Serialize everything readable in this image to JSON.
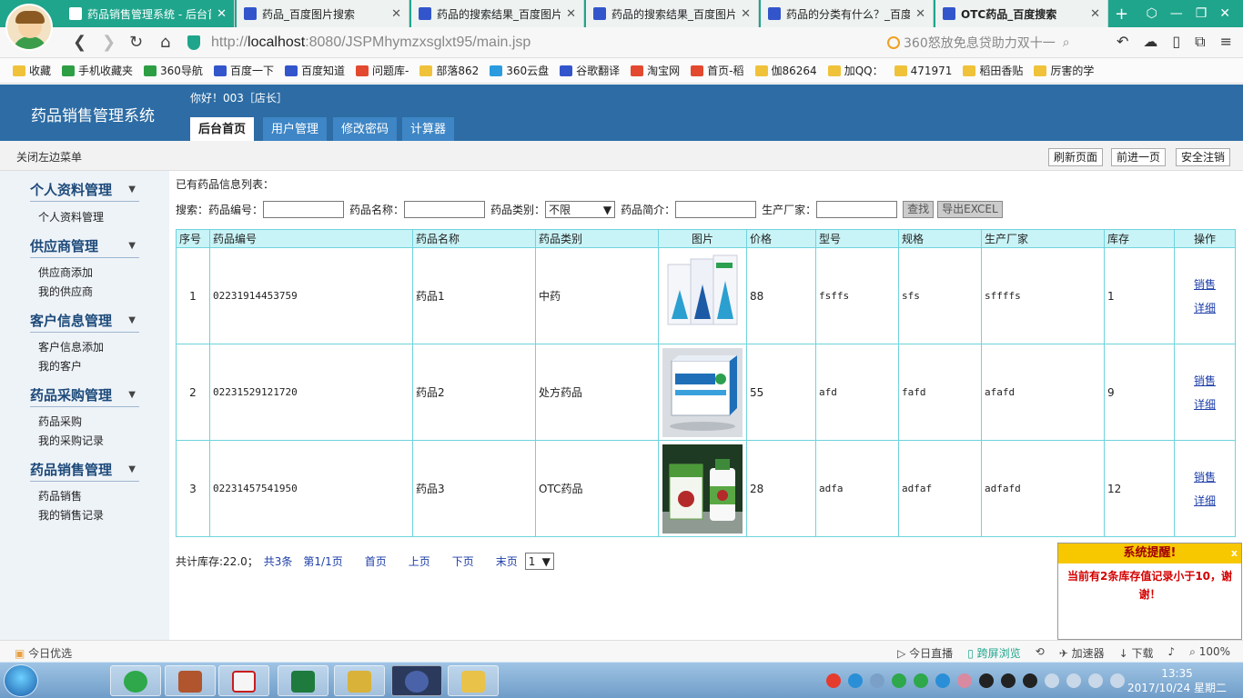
{
  "browser": {
    "tabs": [
      {
        "label": "药品销售管理系统 - 后台首页",
        "active": true
      },
      {
        "label": "药品_百度图片搜索"
      },
      {
        "label": "药品的搜索结果_百度图片"
      },
      {
        "label": "药品的搜索结果_百度图片"
      },
      {
        "label": "药品的分类有什么？_百度"
      },
      {
        "label": "OTC药品_百度搜索"
      }
    ],
    "url_prefix": "http://",
    "url_host": "localhost",
    "url_path": ":8080/JSPMhymzxsglxt95/main.jsp",
    "search_text": "360怒放免息贷助力双十一",
    "bookmarks": [
      "收藏",
      "手机收藏夹",
      "360导航",
      "百度一下",
      "百度知道",
      "问题库-",
      "部落862",
      "360云盘",
      "谷歌翻译",
      "淘宝网",
      "首页-稻",
      "伽86264",
      "加QQ：",
      "471971",
      "稻田香贴",
      "厉害的学"
    ]
  },
  "app": {
    "title": "药品销售管理系统",
    "greeting": "你好！003［店长］",
    "nav_tabs": [
      "后台首页",
      "用户管理",
      "修改密码",
      "计算器"
    ],
    "close_menu": "关闭左边菜单",
    "top_buttons": [
      "刷新页面",
      "前进一页",
      "安全注销"
    ]
  },
  "sidebar": {
    "groups": [
      {
        "title": "个人资料管理",
        "items": [
          "个人资料管理"
        ]
      },
      {
        "title": "供应商管理",
        "items": [
          "供应商添加",
          "我的供应商"
        ]
      },
      {
        "title": "客户信息管理",
        "items": [
          "客户信息添加",
          "我的客户"
        ]
      },
      {
        "title": "药品采购管理",
        "items": [
          "药品采购",
          "我的采购记录"
        ]
      },
      {
        "title": "药品销售管理",
        "items": [
          "药品销售",
          "我的销售记录"
        ]
      }
    ]
  },
  "main": {
    "list_title": "已有药品信息列表：",
    "search": {
      "label": "搜索：",
      "code_label": "药品编号：",
      "name_label": "药品名称：",
      "category_label": "药品类别：",
      "category_value": "不限",
      "intro_label": "药品简介：",
      "maker_label": "生产厂家：",
      "search_button": "查找",
      "export_button": "导出EXCEL"
    },
    "table": {
      "headers": [
        "序号",
        "药品编号",
        "药品名称",
        "药品类别",
        "图片",
        "价格",
        "型号",
        "规格",
        "生产厂家",
        "库存",
        "操作"
      ],
      "rows": [
        {
          "no": "1",
          "code": "02231914453759",
          "name": "药品1",
          "category": "中药",
          "price": "88",
          "model": "fsffs",
          "spec": "sfs",
          "maker": "sffffs",
          "stock": "1",
          "image": "white medicine boxes"
        },
        {
          "no": "2",
          "code": "02231529121720",
          "name": "药品2",
          "category": "处方药品",
          "price": "55",
          "model": "afd",
          "spec": "fafd",
          "maker": "afafd",
          "stock": "9",
          "image": "blue medicine box"
        },
        {
          "no": "3",
          "code": "02231457541950",
          "name": "药品3",
          "category": "OTC药品",
          "price": "28",
          "model": "adfa",
          "spec": "adfaf",
          "maker": "adfafd",
          "stock": "12",
          "image": "green bottle and box"
        }
      ],
      "ops": [
        "销售",
        "详细"
      ]
    },
    "pager": {
      "stock_total": "共计库存:22.0；",
      "count": "共3条",
      "page": "第1/1页",
      "first": "首页",
      "prev": "上页",
      "next": "下页",
      "last": "末页",
      "select_value": "1"
    }
  },
  "alert": {
    "title": "系统提醒!",
    "close": "x",
    "message": "当前有2条库存值记录小于10，谢谢！"
  },
  "statusbar": {
    "left": "今日优选",
    "live": "今日直播",
    "cross": "跨屏浏览",
    "accelerate": "加速器",
    "download": "下载",
    "zoom": "100%"
  },
  "taskbar": {
    "time": "13:35",
    "date": "2017/10/24 星期二"
  },
  "colors": {
    "browser_accent": "#1fa58c",
    "header_blue": "#2d6ca4",
    "table_border": "#6fd3dc",
    "table_header_bg": "#c9f4f7",
    "alert_yellow": "#f7c700",
    "alert_red": "#d40000"
  }
}
